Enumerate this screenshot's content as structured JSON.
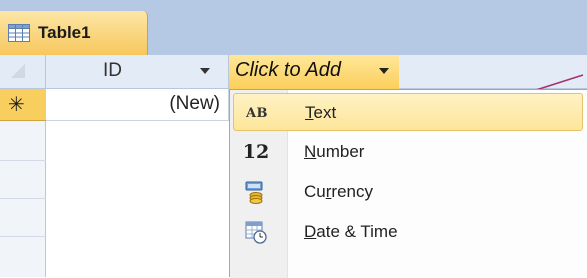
{
  "tab": {
    "label": "Table1",
    "icon": "table-icon"
  },
  "header": {
    "id_column": "ID",
    "add_column": "Click to Add"
  },
  "new_row": {
    "marker": "✳",
    "id_value": "(New)"
  },
  "menu": {
    "items": [
      {
        "icon_text": "AB",
        "label_prefix": "",
        "label_ul": "T",
        "label_rest": "ext",
        "icon": "text-type-icon",
        "highlighted": true
      },
      {
        "icon_text": "12",
        "label_prefix": "",
        "label_ul": "N",
        "label_rest": "umber",
        "icon": "number-type-icon",
        "highlighted": false
      },
      {
        "icon_text": "",
        "label_prefix": "Cu",
        "label_ul": "r",
        "label_rest": "rency",
        "icon": "currency-type-icon",
        "highlighted": false
      },
      {
        "icon_text": "",
        "label_prefix": "",
        "label_ul": "D",
        "label_rest": "ate & Time",
        "icon": "date-time-type-icon",
        "highlighted": false
      }
    ]
  },
  "colors": {
    "tab_gold": "#f7c75d",
    "strip_blue": "#b5c8e4",
    "highlight": "#fde59a",
    "pointer_arrow": "#a0326e"
  }
}
